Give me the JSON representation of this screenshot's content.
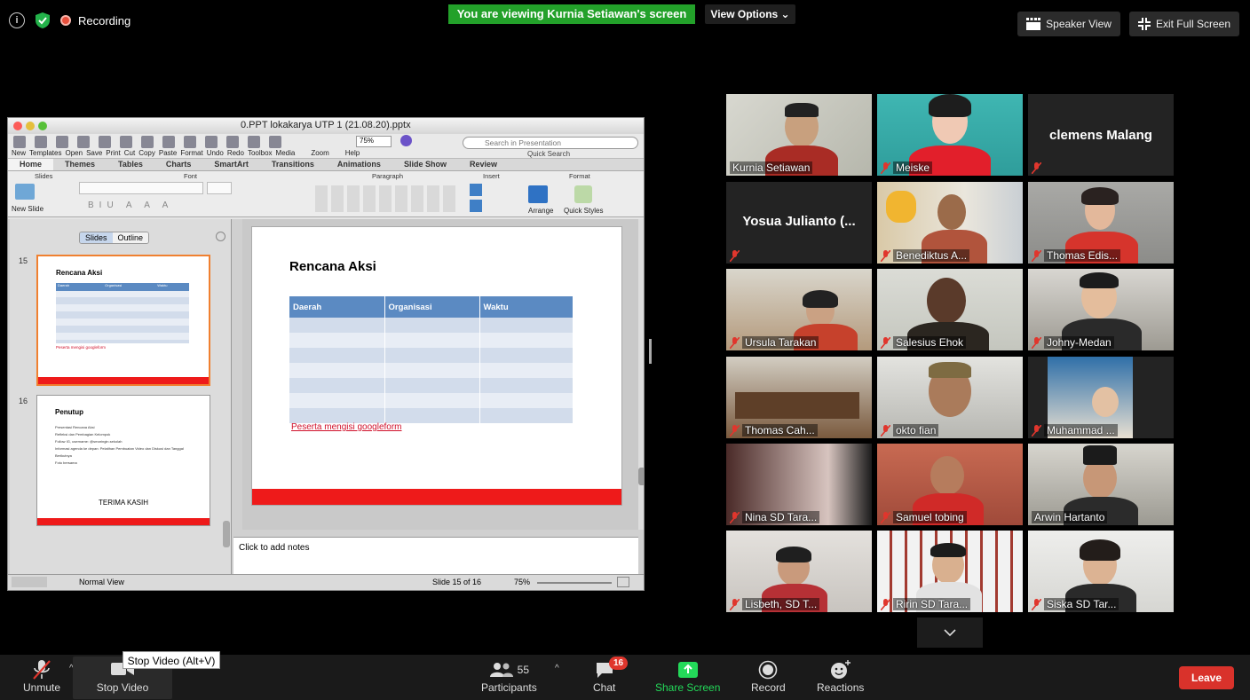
{
  "topbar": {
    "recording_label": "Recording",
    "viewing_banner": "You are viewing Kurnia Setiawan's screen",
    "view_options": "View Options ⌄",
    "speaker_view": "Speaker View",
    "exit_full_screen": "Exit Full Screen"
  },
  "ppt": {
    "window_title": "0.PPT lokakarya UTP 1 (21.08.20).pptx",
    "toolbar_labels": [
      "New",
      "Templates",
      "Open",
      "Save",
      "Print",
      "Cut",
      "Copy",
      "Paste",
      "Format",
      "Undo",
      "Redo",
      "Toolbox",
      "Media",
      "Zoom",
      "Help"
    ],
    "zoom_value": "75%",
    "search_placeholder": "Search in Presentation",
    "quick_search": "Quick Search",
    "ribbon_tabs": [
      "Home",
      "Themes",
      "Tables",
      "Charts",
      "SmartArt",
      "Transitions",
      "Animations",
      "Slide Show",
      "Review"
    ],
    "ribbon_groups": {
      "slides": "Slides",
      "font": "Font",
      "paragraph": "Paragraph",
      "insert": "Insert",
      "format": "Format",
      "new_slide": "New Slide",
      "arrange": "Arrange",
      "quick_styles": "Quick Styles"
    },
    "pane_tabs": [
      "Slides",
      "Outline"
    ],
    "thumb15": {
      "number": "15",
      "title": "Rencana Aksi",
      "headers": [
        "Daerah",
        "Organisasi",
        "Waktu"
      ],
      "link": "Peserta mengisi googleform"
    },
    "thumb16": {
      "number": "16",
      "title": "Penutup",
      "lines": [
        "Presentasi Rencana Aksi",
        "Refleksi dan Pembagian Kelompok",
        "Follow IG, username: @smaringin.sekolah",
        "Informasi agenda ke depan: Pelatihan Pembuatan Video dan Diskusi dan Tanggal Berikutnya",
        "Foto bersama"
      ],
      "closing": "TERIMA KASIH"
    },
    "slide": {
      "title": "Rencana Aksi",
      "headers": [
        "Daerah",
        "Organisasi",
        "Waktu"
      ],
      "link": "Peserta mengisi googleform"
    },
    "notes_placeholder": "Click to add notes",
    "status": {
      "view": "Normal View",
      "slide_of": "Slide 15 of 16",
      "zoom": "75%"
    }
  },
  "participants_tiles": [
    {
      "name": "Kurnia Setiawan",
      "muted": false
    },
    {
      "name": "Meiske",
      "muted": true
    },
    {
      "name": "clemens Malang",
      "muted": true,
      "no_video": true
    },
    {
      "name": "Yosua Julianto (...",
      "muted": true,
      "no_video": true
    },
    {
      "name": "Benediktus A...",
      "muted": true
    },
    {
      "name": "Thomas Edis...",
      "muted": true
    },
    {
      "name": "Ursula Tarakan",
      "muted": true
    },
    {
      "name": "Salesius Ehok",
      "muted": true
    },
    {
      "name": "Johny-Medan",
      "muted": true
    },
    {
      "name": "Thomas Cah...",
      "muted": true
    },
    {
      "name": "okto fian",
      "muted": true
    },
    {
      "name": "Muhammad ...",
      "muted": true
    },
    {
      "name": "Nina SD Tara...",
      "muted": true
    },
    {
      "name": "Samuel tobing",
      "muted": true
    },
    {
      "name": "Arwin Hartanto",
      "muted": false
    },
    {
      "name": "Lisbeth, SD T...",
      "muted": true
    },
    {
      "name": "Ririn SD Tara...",
      "muted": true
    },
    {
      "name": "Siska SD Tar...",
      "muted": true
    }
  ],
  "controls": {
    "unmute": "Unmute",
    "stop_video": "Stop Video",
    "tooltip": "Stop Video (Alt+V)",
    "participants": "Participants",
    "participants_count": "55",
    "chat": "Chat",
    "chat_badge": "16",
    "share_screen": "Share Screen",
    "record": "Record",
    "reactions": "Reactions",
    "leave": "Leave"
  },
  "colors": {
    "banner_green": "#23a12a",
    "share_green": "#23d959",
    "leave_red": "#d9322b",
    "mute_red": "#e0362d",
    "slide_header_blue": "#5b8ac2",
    "slide_red_bar": "#ee1a1a"
  }
}
